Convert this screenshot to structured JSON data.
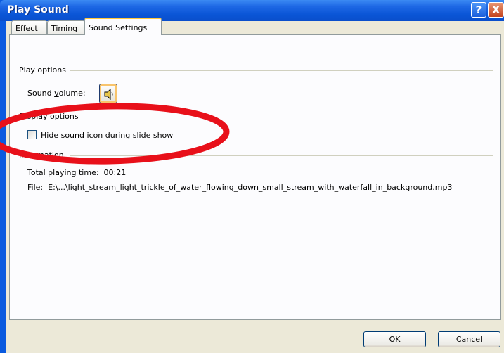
{
  "window": {
    "title": "Play Sound",
    "help_glyph": "?",
    "close_glyph": "X"
  },
  "tabs": [
    {
      "label": "Effect",
      "active": false
    },
    {
      "label": "Timing",
      "active": false
    },
    {
      "label": "Sound Settings",
      "active": true
    }
  ],
  "play_options": {
    "group_label": "Play options",
    "volume_label_prefix": "Sound ",
    "volume_label_accel": "v",
    "volume_label_suffix": "olume:",
    "volume_icon": "speaker-icon"
  },
  "display_options": {
    "group_label": "Display options",
    "checkbox_accel": "H",
    "checkbox_rest": "ide sound icon during slide show",
    "checked": false
  },
  "information": {
    "group_label": "Information",
    "total_time_label": "Total playing time:",
    "total_time_value": "00:21",
    "file_label": "File:",
    "file_value": "E:\\...\\light_stream_light_trickle_of_water_flowing_down_small_stream_with_waterfall_in_background.mp3"
  },
  "buttons": {
    "ok": "OK",
    "cancel": "Cancel"
  },
  "annotation": {
    "color": "#E8101A"
  }
}
